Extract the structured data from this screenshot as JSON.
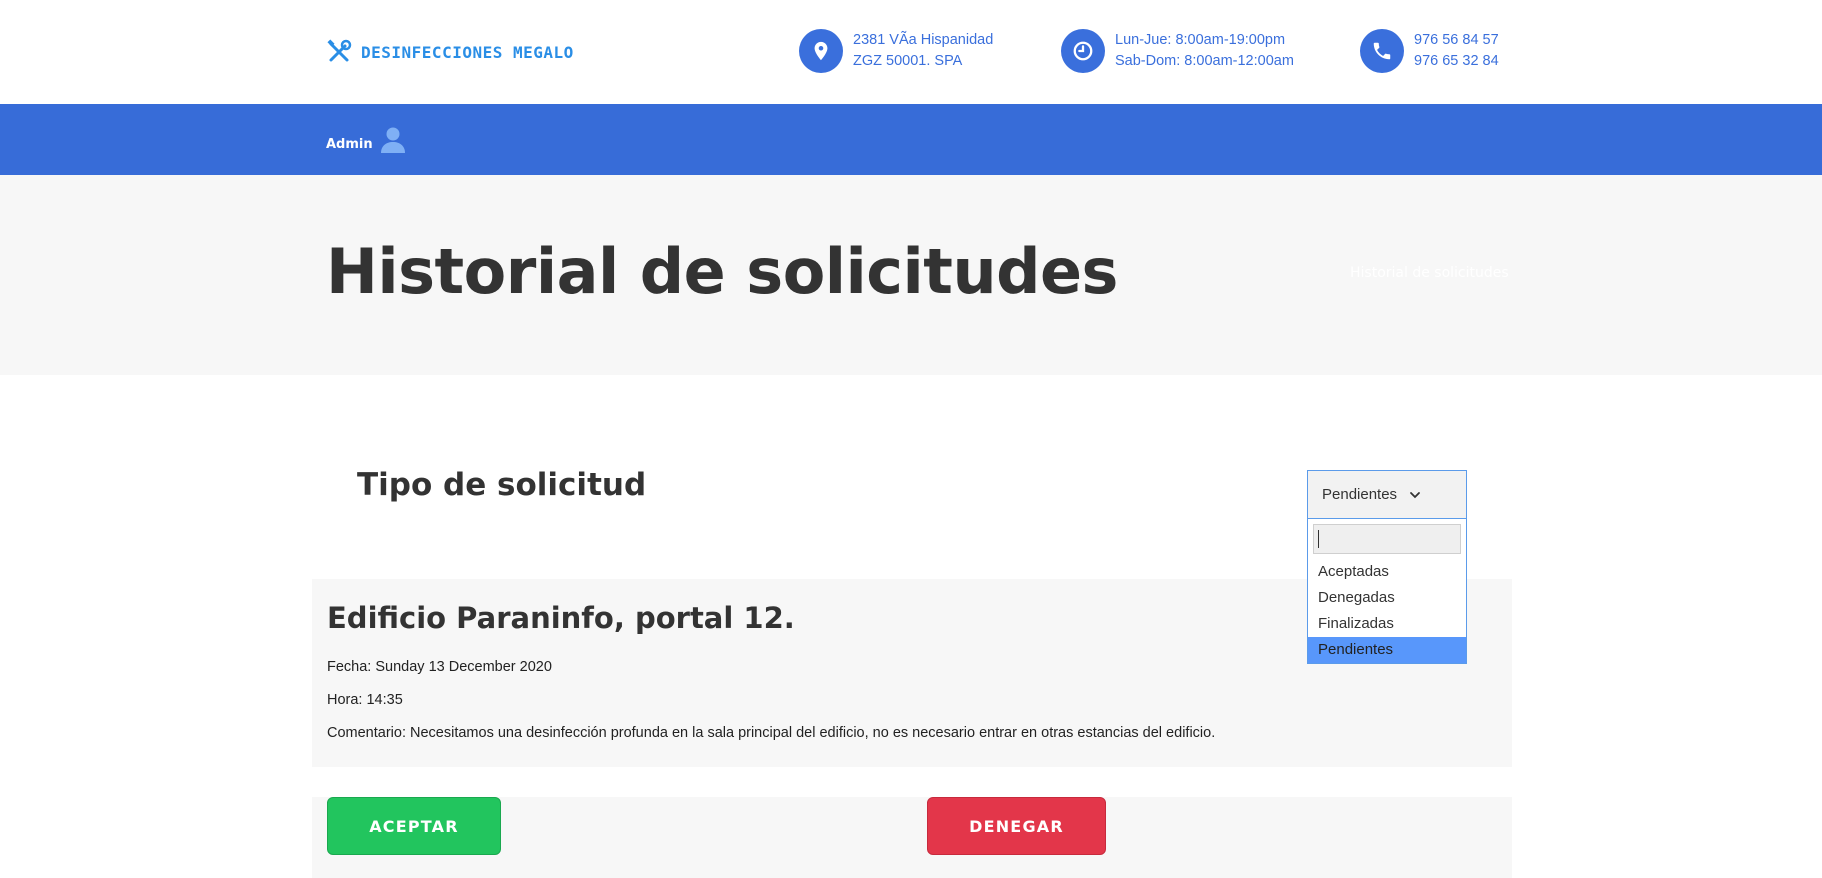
{
  "header": {
    "brand_name": "DESINFECCIONES MEGALO",
    "brand_icon": "tools-icon",
    "address": {
      "icon": "location-pin-icon",
      "line1": "2381 VÃa Hispanidad",
      "line2": "ZGZ 50001. SPA"
    },
    "hours": {
      "icon": "clock-icon",
      "line1": "Lun-Jue: 8:00am-19:00pm",
      "line2": "Sab-Dom: 8:00am-12:00am"
    },
    "phone": {
      "icon": "phone-icon",
      "line1": "976 56 84 57",
      "line2": "976 65 32 84"
    },
    "accent_color": "#3a6fdc"
  },
  "nav": {
    "admin_label": "Admin",
    "admin_icon": "user-icon",
    "bar_color": "#376cd8"
  },
  "page": {
    "title": "Historial de solicitudes",
    "faint_breadcrumb": "Historial de solicitudes"
  },
  "filter": {
    "label": "Tipo de solicitud",
    "selected": "Pendientes",
    "search_value": "",
    "options": [
      "Aceptadas",
      "Denegadas",
      "Finalizadas",
      "Pendientes"
    ],
    "highlighted_index": 3
  },
  "request": {
    "title": "Edificio Paraninfo, portal 12.",
    "date": "Fecha: Sunday 13 December 2020",
    "time": "Hora: 14:35",
    "comment": "Comentario: Necesitamos una desinfección profunda en la sala principal del edificio, no es necesario entrar en otras estancias del edificio."
  },
  "actions": {
    "accept_label": "ACEPTAR",
    "deny_label": "DENEGAR",
    "accept_color": "#22c55e",
    "deny_color": "#e3364a"
  }
}
